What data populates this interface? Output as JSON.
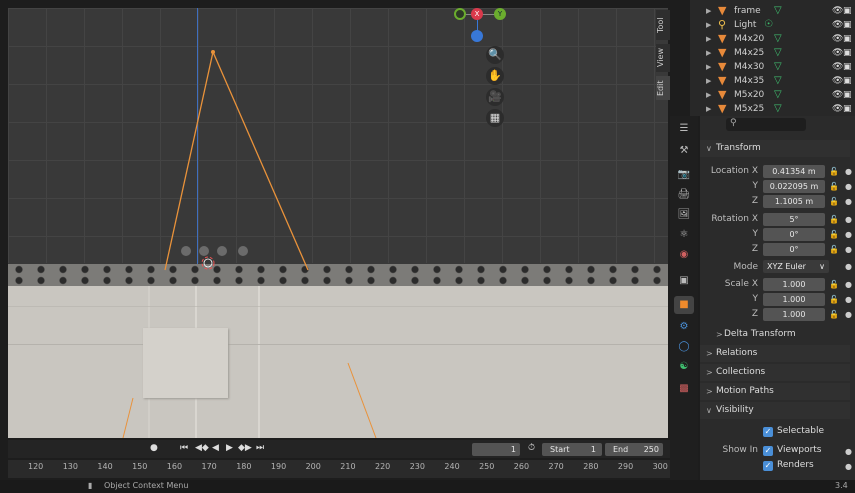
{
  "viewport": {
    "gizmo": {
      "x_label": "X",
      "y_label": "Y",
      "x_color": "#d9394b",
      "y_color": "#6bad2e",
      "z_color": "#3878d8"
    },
    "nav_icons": [
      "zoom-icon",
      "hand-pan-icon",
      "camera-icon",
      "grid-icon"
    ]
  },
  "side_tabs": {
    "tool": "Tool",
    "view": "View",
    "edit": "Edit"
  },
  "outliner": {
    "items": [
      {
        "name": "frame"
      },
      {
        "name": "Light"
      },
      {
        "name": "M4x20"
      },
      {
        "name": "M4x25"
      },
      {
        "name": "M4x30"
      },
      {
        "name": "M4x35"
      },
      {
        "name": "M5x20"
      },
      {
        "name": "M5x25"
      }
    ]
  },
  "properties": {
    "search_placeholder": "",
    "transform": {
      "title": "Transform",
      "location": {
        "label": "Location X",
        "y_label": "Y",
        "z_label": "Z",
        "x": "0.41354 m",
        "y": "0.022095 m",
        "z": "1.1005 m"
      },
      "rotation": {
        "label": "Rotation X",
        "y_label": "Y",
        "z_label": "Z",
        "x": "5°",
        "y": "0°",
        "z": "0°"
      },
      "mode": {
        "label": "Mode",
        "value": "XYZ Euler"
      },
      "scale": {
        "label": "Scale X",
        "y_label": "Y",
        "z_label": "Z",
        "x": "1.000",
        "y": "1.000",
        "z": "1.000"
      }
    },
    "delta_transform": "Delta Transform",
    "relations": "Relations",
    "collections": "Collections",
    "motion_paths": "Motion Paths",
    "visibility": {
      "title": "Visibility",
      "selectable": "Selectable",
      "show_in": "Show In",
      "viewports": "Viewports",
      "renders": "Renders"
    }
  },
  "timeline": {
    "current_frame": "1",
    "start_label": "Start",
    "start": "1",
    "end_label": "End",
    "end": "250",
    "ticks": [
      "120",
      "130",
      "140",
      "150",
      "160",
      "170",
      "180",
      "190",
      "200",
      "210",
      "220",
      "230",
      "240",
      "250",
      "260",
      "270",
      "280",
      "290",
      "300"
    ]
  },
  "status": {
    "context_menu": "Object Context Menu",
    "version": "3.4"
  }
}
